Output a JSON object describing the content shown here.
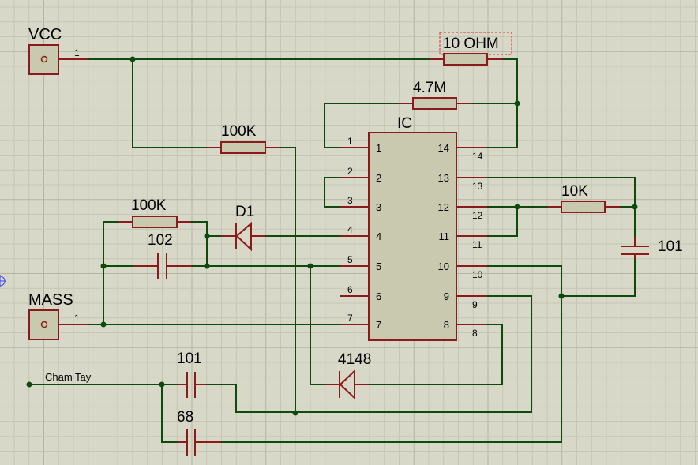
{
  "terminals": {
    "vcc": "VCC",
    "mass": "MASS",
    "vcc_pin": "1",
    "mass_pin": "1"
  },
  "net_labels": {
    "touch": "Cham Tay"
  },
  "ic": {
    "name": "IC",
    "left_pins": [
      "1",
      "2",
      "3",
      "4",
      "5",
      "6",
      "7"
    ],
    "right_pins": [
      "14",
      "13",
      "12",
      "11",
      "10",
      "9",
      "8"
    ]
  },
  "components": {
    "r_top": "10 OHM",
    "r_feedback": "4.7M",
    "r_vcc": "100K",
    "r_left": "100K",
    "diode_d1": "D1",
    "cap_left": "102",
    "r_right": "10K",
    "cap_right": "101",
    "diode_4148": "4148",
    "cap_touch": "101",
    "cap_bottom": "68"
  },
  "colors": {
    "background": "#d8d8c8",
    "grid_minor": "#c6c6b4",
    "grid_major": "#b4b4a2",
    "wire": "#0e4a0e",
    "component": "#8b1a1a",
    "ic_fill": "#c9c9b0",
    "terminal_fill": "#c9c9b0",
    "selection": "#e03030"
  }
}
